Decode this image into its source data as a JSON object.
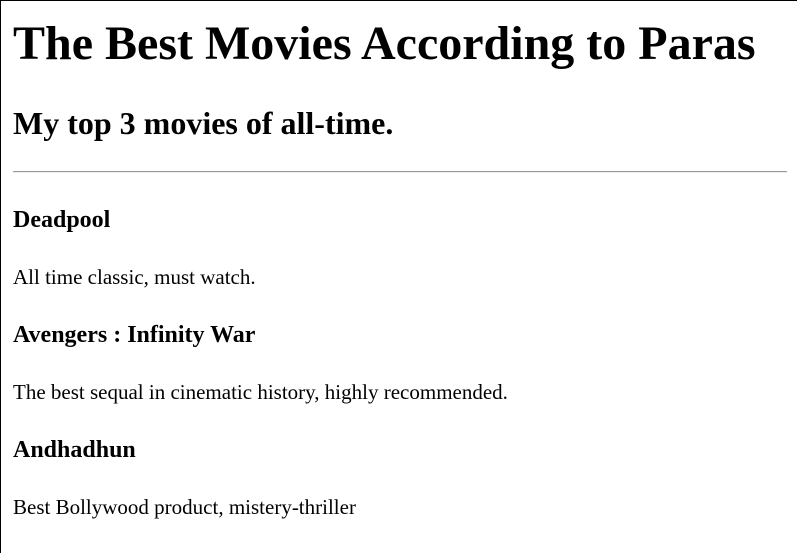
{
  "header": {
    "title": "The Best Movies According to Paras",
    "subtitle": "My top 3 movies of all-time."
  },
  "movies": [
    {
      "title": "Deadpool",
      "description": "All time classic, must watch."
    },
    {
      "title": "Avengers : Infinity War",
      "description": "The best sequal in cinematic history, highly recommended."
    },
    {
      "title": "Andhadhun",
      "description": "Best Bollywood product, mistery-thriller"
    }
  ]
}
